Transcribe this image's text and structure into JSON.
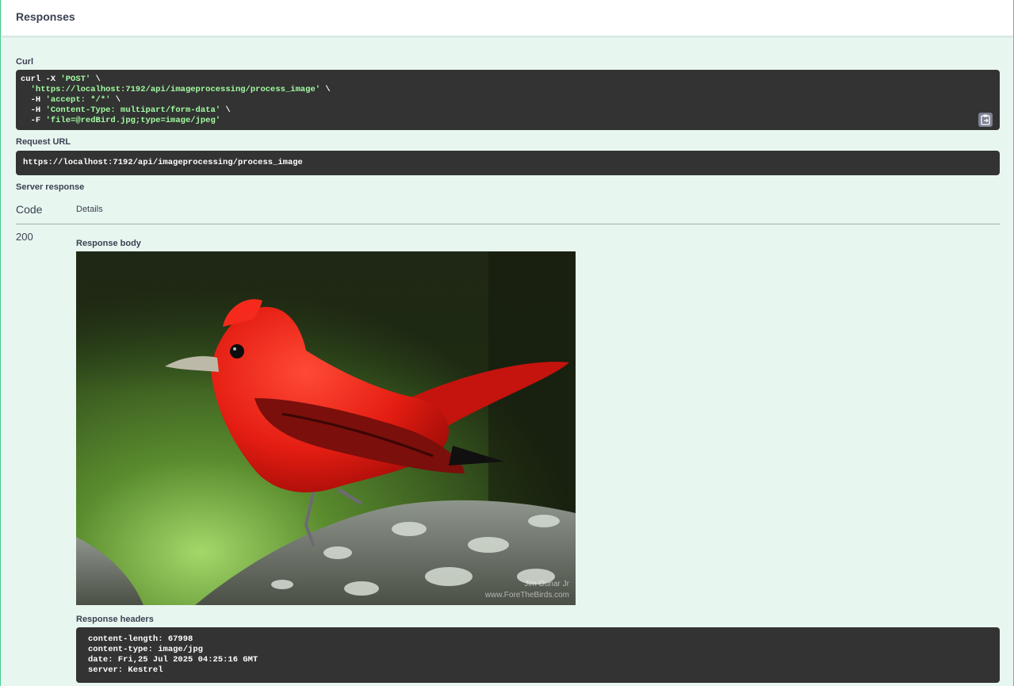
{
  "section": {
    "title": "Responses"
  },
  "curl": {
    "label": "Curl",
    "lines": [
      {
        "prefix": "curl -X ",
        "str": "'POST'",
        "suffix": " \\"
      },
      {
        "prefix": "  ",
        "str": "'https://localhost:7192/api/imageprocessing/process_image'",
        "suffix": " \\"
      },
      {
        "prefix": "  -H ",
        "str": "'accept: */*'",
        "suffix": " \\"
      },
      {
        "prefix": "  -H ",
        "str": "'Content-Type: multipart/form-data'",
        "suffix": " \\"
      },
      {
        "prefix": "  -F ",
        "str": "'file=@redBird.jpg;type=image/jpeg'",
        "suffix": ""
      }
    ],
    "copy_icon": "clipboard-copy-icon"
  },
  "request_url": {
    "label": "Request URL",
    "value": "https://localhost:7192/api/imageprocessing/process_image"
  },
  "server_response": {
    "label": "Server response",
    "columns": {
      "code": "Code",
      "details": "Details"
    },
    "code": "200",
    "body_label": "Response body",
    "image_alt": "red bird perched on a lichen-covered branch",
    "image_watermark": "Jim Dunar Jr  www.ForeTheBirds.com",
    "headers_label": "Response headers",
    "headers": [
      "content-length: 67998",
      "content-type: image/jpg",
      "date: Fri,25 Jul 2025 04:25:16 GMT",
      "server: Kestrel"
    ]
  },
  "colors": {
    "accent": "#49cc90",
    "panel_bg": "#e8f6f0",
    "code_bg": "#333333",
    "code_string": "#a2fca2"
  }
}
